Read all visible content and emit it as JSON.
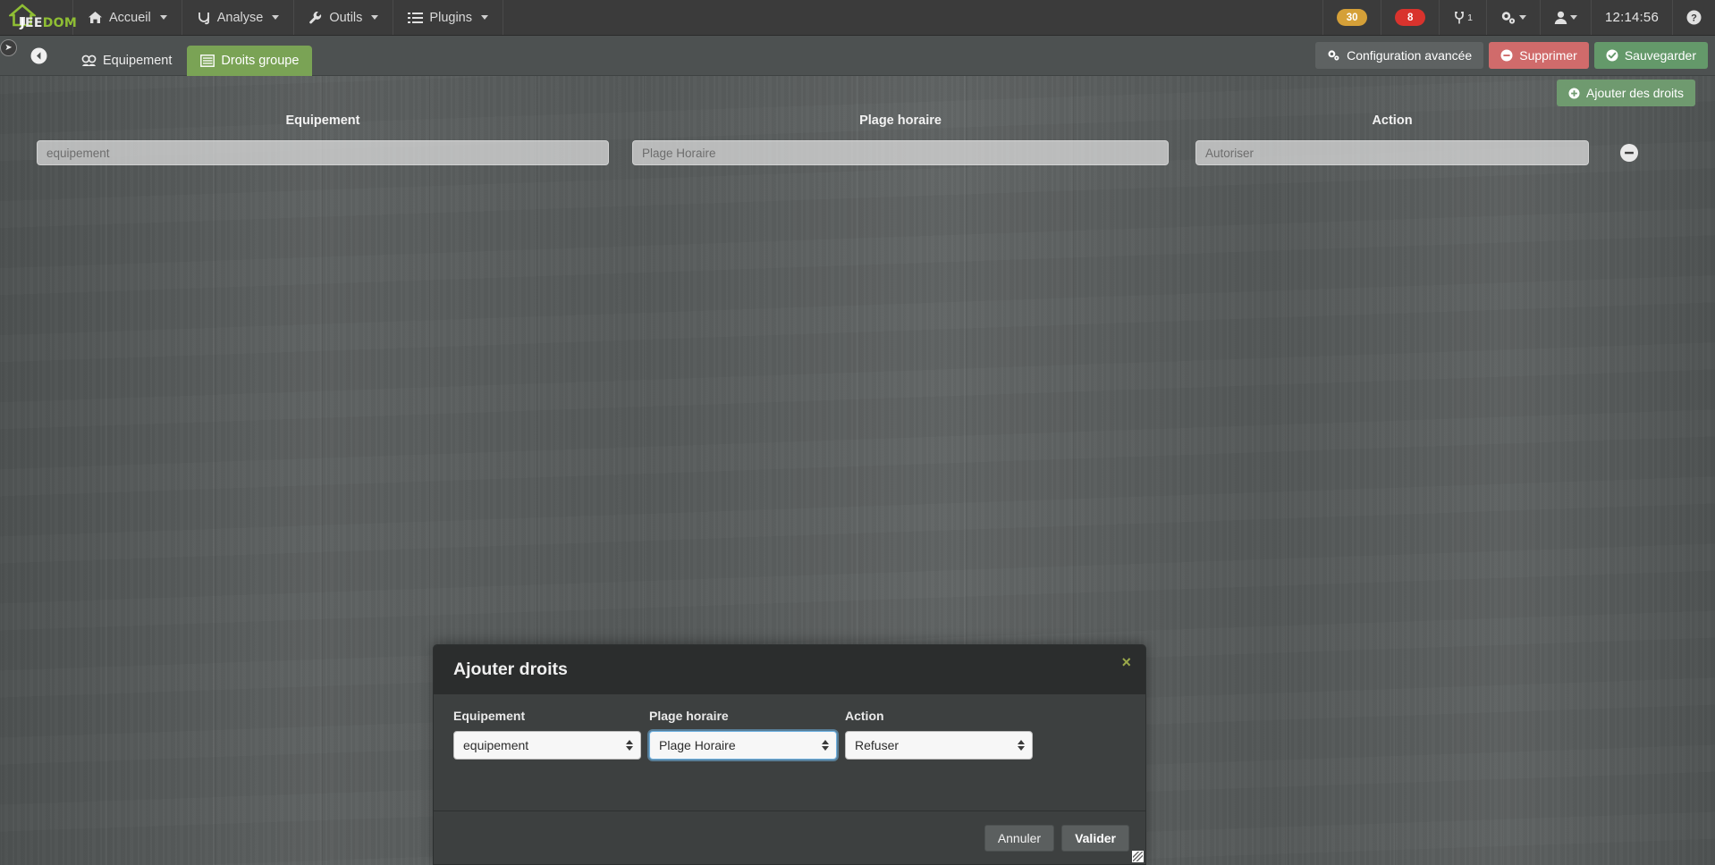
{
  "navbar": {
    "brand": {
      "j": "J",
      "ee": "EE",
      "dom": "DOM",
      "icon": "house-icon"
    },
    "menus": [
      {
        "label": "Accueil",
        "icon": "home-icon"
      },
      {
        "label": "Analyse",
        "icon": "analytics-icon"
      },
      {
        "label": "Outils",
        "icon": "wrench-icon"
      },
      {
        "label": "Plugins",
        "icon": "list-icon"
      }
    ],
    "right": {
      "badge_update": "30",
      "badge_message": "8",
      "plug_icon": "plug-icon",
      "plug_count": "1",
      "gear_icon": "gears-icon",
      "user_icon": "user-icon",
      "clock": "12:14:56",
      "help_icon": "help-circle-icon"
    },
    "colors": {
      "badge_orange": "#d5a038",
      "badge_red": "#d9332d",
      "brand_green": "#8fbe34"
    }
  },
  "side_toggle": {
    "icon": "arrow-right-circle-icon"
  },
  "tabbar": {
    "back_icon": "arrow-left-circle-icon",
    "tabs": [
      {
        "label": "Equipement",
        "icon": "dashboard-icon",
        "active": false
      },
      {
        "label": "Droits groupe",
        "icon": "table-icon",
        "active": true
      }
    ],
    "buttons": [
      {
        "label": "Configuration avancée",
        "icon": "gears-icon",
        "style": "default"
      },
      {
        "label": "Supprimer",
        "icon": "minus-circle-icon",
        "style": "danger"
      },
      {
        "label": "Sauvegarder",
        "icon": "check-circle-icon",
        "style": "success"
      }
    ]
  },
  "actionbar": {
    "add_rights": {
      "label": "Ajouter des droits",
      "icon": "plus-circle-icon"
    }
  },
  "rights_table": {
    "headers": [
      "Equipement",
      "Plage horaire",
      "Action"
    ],
    "rows": [
      {
        "equipement": "equipement",
        "plage_horaire": "Plage Horaire",
        "action": "Autoriser",
        "remove_icon": "minus-circle-icon"
      }
    ]
  },
  "modal": {
    "title": "Ajouter droits",
    "close_icon": "close-icon",
    "close_label": "×",
    "fields": [
      {
        "label": "Equipement",
        "value": "equipement",
        "focused": false
      },
      {
        "label": "Plage horaire",
        "value": "Plage Horaire",
        "focused": true
      },
      {
        "label": "Action",
        "value": "Refuser",
        "focused": false
      }
    ],
    "footer": {
      "cancel": "Annuler",
      "confirm": "Valider"
    },
    "resize_icon": "resize-grip-icon"
  }
}
